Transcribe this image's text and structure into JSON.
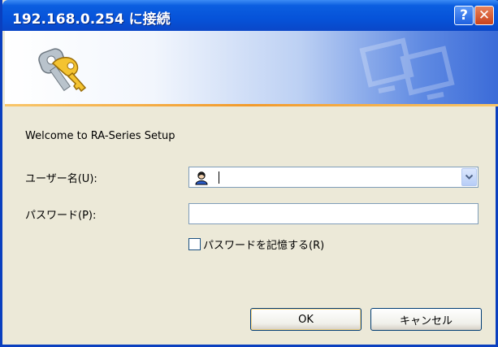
{
  "window": {
    "title": "192.168.0.254 に接続",
    "help_glyph": "?",
    "close_glyph": "✕",
    "accent": "#0653d9"
  },
  "banner": {
    "icon": "keys-icon",
    "watermark_icon": "computers-watermark-icon"
  },
  "message": "Welcome to RA-Series Setup",
  "form": {
    "username_label": "ユーザー名(U):",
    "username_value": "",
    "user_icon": "user-icon",
    "password_label": "パスワード(P):",
    "password_value": "",
    "remember_label": "パスワードを記憶する(R)",
    "remember_checked": false
  },
  "buttons": {
    "ok": "OK",
    "cancel": "キャンセル"
  }
}
